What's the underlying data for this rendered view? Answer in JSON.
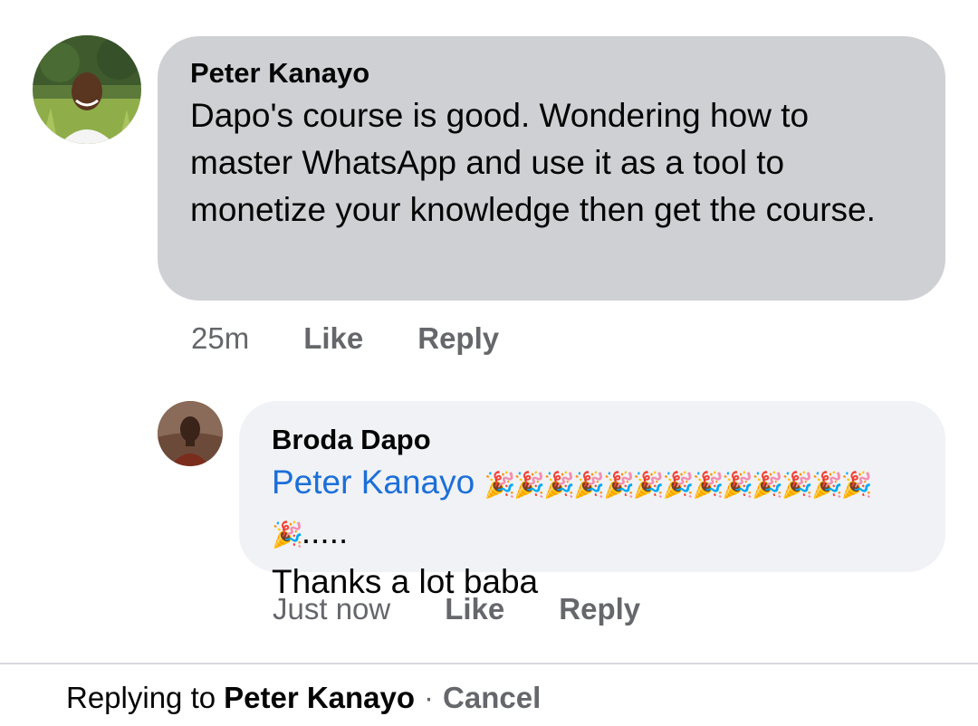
{
  "comments": [
    {
      "author": "Peter Kanayo",
      "text": "Dapo's course is good. Wondering how to master WhatsApp and use it as a tool to monetize your knowledge then get the course.",
      "time": "25m",
      "like_label": "Like",
      "reply_label": "Reply",
      "avatar_icon": "profile-photo"
    },
    {
      "author": "Broda Dapo",
      "mention": "Peter Kanayo",
      "emojis": "🎉🎉🎉🎉🎉🎉🎉🎉🎉🎉🎉🎉🎉🎉",
      "emoji_trail": ".....",
      "text": "Thanks a lot baba",
      "time": "Just now",
      "like_label": "Like",
      "reply_label": "Reply",
      "avatar_icon": "profile-photo"
    }
  ],
  "reply_bar": {
    "prefix": "Replying to",
    "target": "Peter Kanayo",
    "separator": "·",
    "cancel_label": "Cancel"
  },
  "colors": {
    "bubble_primary": "#ced0d4",
    "bubble_reply": "#f0f2f5",
    "mention": "#1c6fd8",
    "meta": "#65676b"
  }
}
